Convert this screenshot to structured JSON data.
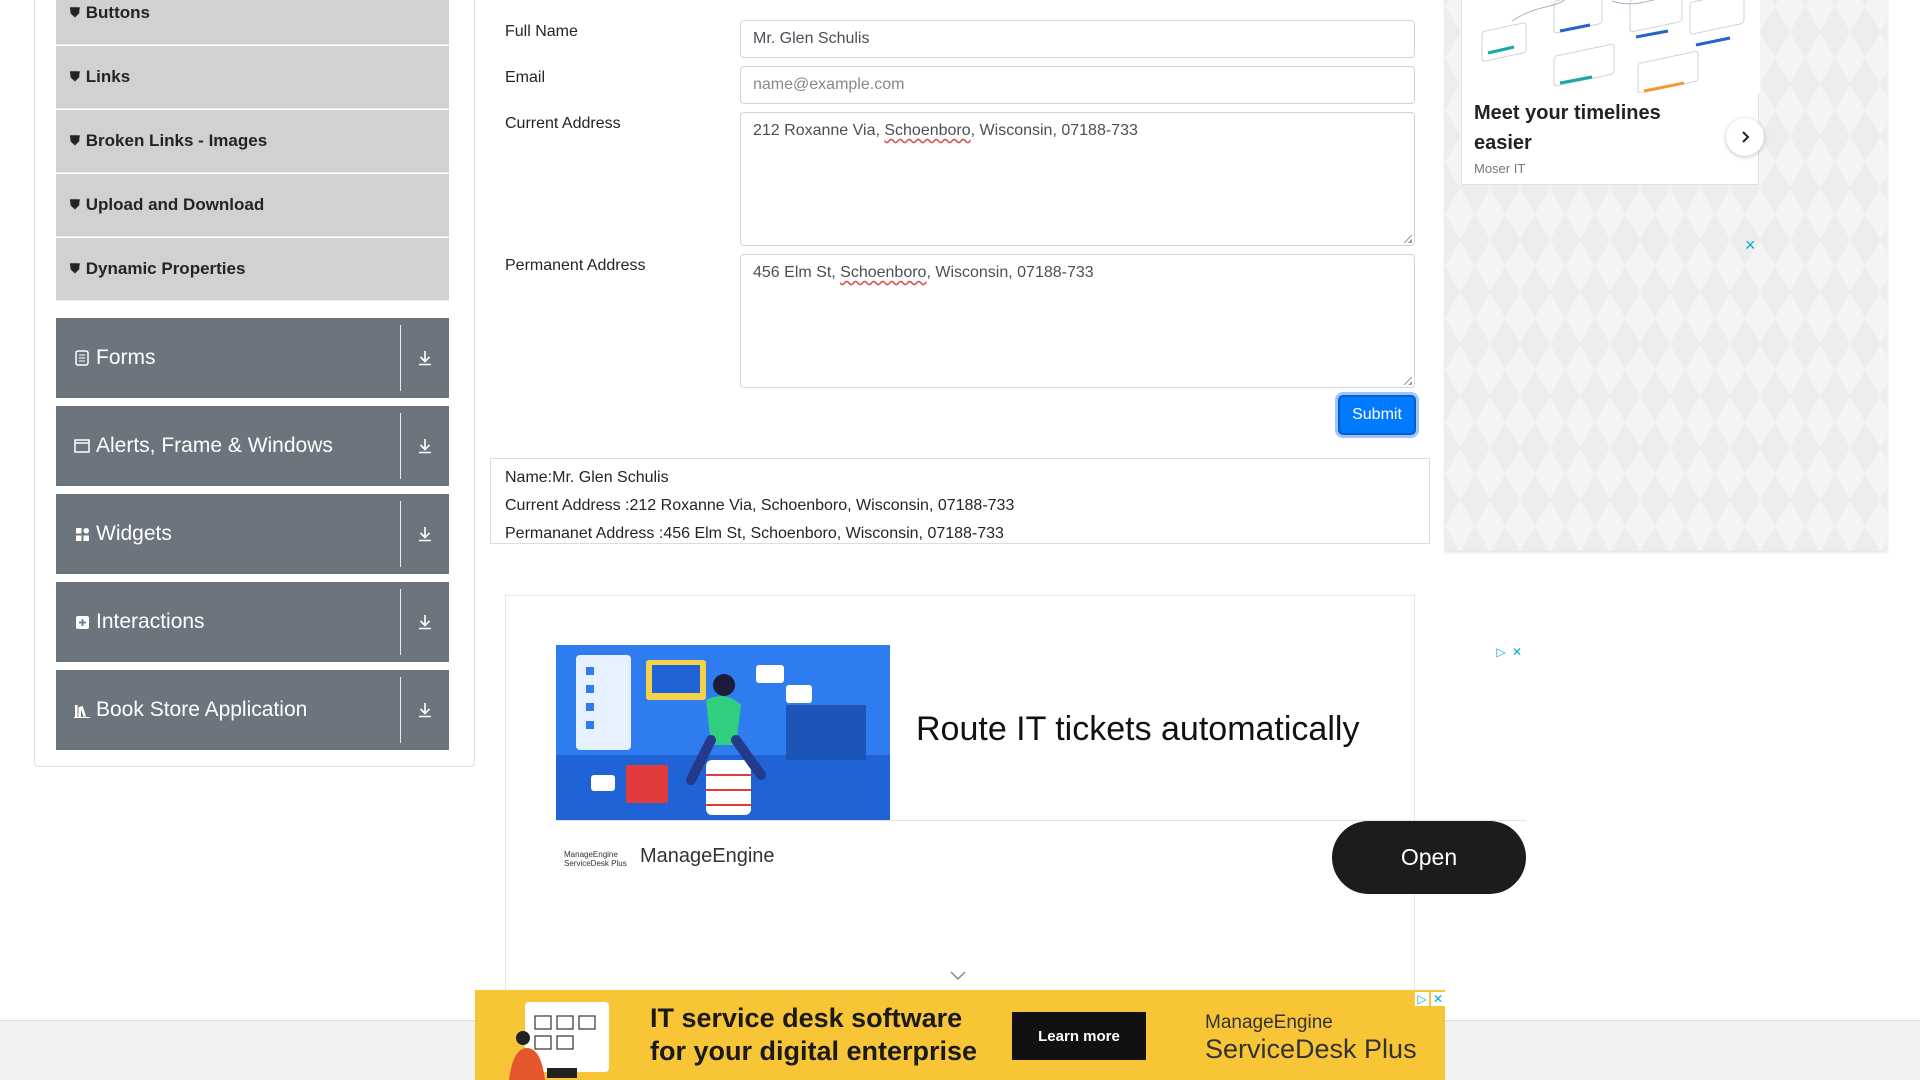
{
  "sidebar": {
    "sub_items": [
      {
        "label": "Buttons"
      },
      {
        "label": "Links"
      },
      {
        "label": "Broken Links - Images"
      },
      {
        "label": "Upload and Download"
      },
      {
        "label": "Dynamic Properties"
      }
    ],
    "groups": [
      {
        "label": "Forms",
        "icon": "document-icon"
      },
      {
        "label": "Alerts, Frame & Windows",
        "icon": "window-icon"
      },
      {
        "label": "Widgets",
        "icon": "widgets-icon"
      },
      {
        "label": "Interactions",
        "icon": "interactions-icon"
      },
      {
        "label": "Book Store Application",
        "icon": "books-icon"
      }
    ]
  },
  "form": {
    "full_name_label": "Full Name",
    "full_name_value": "Mr. Glen Schulis",
    "email_label": "Email",
    "email_placeholder": "name@example.com",
    "current_address_label": "Current Address",
    "current_address_prefix": "212 Roxanne Via, ",
    "current_address_city": "Schoenboro",
    "current_address_suffix": ", Wisconsin, 07188-733",
    "permanent_address_label": "Permanent Address",
    "permanent_address_prefix": "456 Elm St, ",
    "permanent_address_city": "Schoenboro",
    "permanent_address_suffix": ", Wisconsin, 07188-733",
    "submit_label": "Submit"
  },
  "output": {
    "name_line": "Name:Mr. Glen Schulis",
    "current_line": "Current Address :212 Roxanne Via, Schoenboro, Wisconsin, 07188-733",
    "permanent_line": "Permananet Address :456 Elm St, Schoenboro, Wisconsin, 07188-733"
  },
  "right_ad": {
    "title": "Meet your timelines easier",
    "sponsor": "Moser IT",
    "close_glyph": "×"
  },
  "middle_ad": {
    "headline": "Route IT tickets automatically",
    "brand": "ManageEngine",
    "logo_line1": "ManageEngine",
    "logo_line2": "ServiceDesk Plus",
    "cta": "Open"
  },
  "bottom_ad": {
    "headline_line1": "IT service desk software",
    "headline_line2": "for your digital enterprise",
    "cta": "Learn more",
    "brand_line1": "ManageEngine",
    "brand_line2": "ServiceDesk Plus"
  },
  "colors": {
    "group_bg": "#6c757d",
    "sub_item_bg": "#d1d1d1",
    "submit_bg": "#007bff",
    "bottom_ad_bg": "#f8c537"
  }
}
